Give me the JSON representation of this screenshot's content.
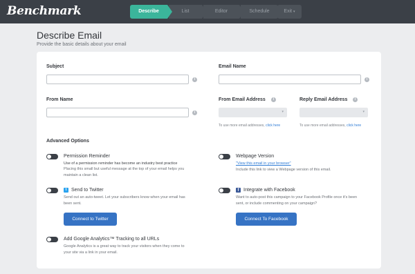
{
  "app": {
    "logo_text": "Benchmark"
  },
  "steps": [
    {
      "label": "Describe",
      "active": true
    },
    {
      "label": "List",
      "active": false
    },
    {
      "label": "Editor",
      "active": false
    },
    {
      "label": "Schedule",
      "active": false
    }
  ],
  "exit": {
    "label": "Exit",
    "caret": "▾"
  },
  "header": {
    "title": "Describe Email",
    "subtitle": "Provide the basic details about your email"
  },
  "form": {
    "subject": {
      "label": "Subject",
      "value": ""
    },
    "email_name": {
      "label": "Email Name",
      "value": ""
    },
    "from_name": {
      "label": "From Name",
      "value": ""
    },
    "from_email": {
      "label": "From Email Address",
      "value": "",
      "help_text": "To use more email addresses, ",
      "help_link": "click here"
    },
    "reply_email": {
      "label": "Reply Email Address",
      "value": "",
      "help_text": "To use more email addresses, ",
      "help_link": "click here"
    }
  },
  "advanced": {
    "title": "Advanced Options",
    "permission_reminder": {
      "title": "Permission Reminder",
      "desc_1": "Use of a permission reminder has become an industry best practice",
      "desc_2": "Placing this small but useful message at the top of your email helps you",
      "desc_3": "maintain a clean list.",
      "enabled": false
    },
    "webpage_version": {
      "title": "Webpage Version",
      "link": "\"View this email in your browser\"",
      "desc": "Include this link to view a Webpage version of this email.",
      "enabled": false
    },
    "send_to_twitter": {
      "title": "Send to Twitter",
      "desc_1": "Send out an auto-tweet. Let your subscribers know when your email has",
      "desc_2": "been sent.",
      "button": "Connect to Twitter",
      "enabled": false
    },
    "integrate_facebook": {
      "title": "Integrate with Facebook",
      "desc_1": "Want to auto-post this campaign to your Facebook Profile once it's been",
      "desc_2": "sent, or include commenting on your campaign?",
      "button": "Connect To Facebook",
      "enabled": false
    },
    "google_analytics": {
      "title": "Add Google Analytics™ Tracking to all URLs",
      "desc_1": "Google Analytics is a great way to track your visitors when they come to",
      "desc_2": "your site via a link in your email.",
      "enabled": false
    }
  },
  "icons": {
    "info": "i",
    "twitter": "t",
    "facebook": "f",
    "select_caret": "▾"
  },
  "colors": {
    "topbar": "#3b4047",
    "active_step": "#3bb59b",
    "button_blue": "#3673c4",
    "link_blue": "#2f7cd6",
    "background": "#ecedef"
  }
}
